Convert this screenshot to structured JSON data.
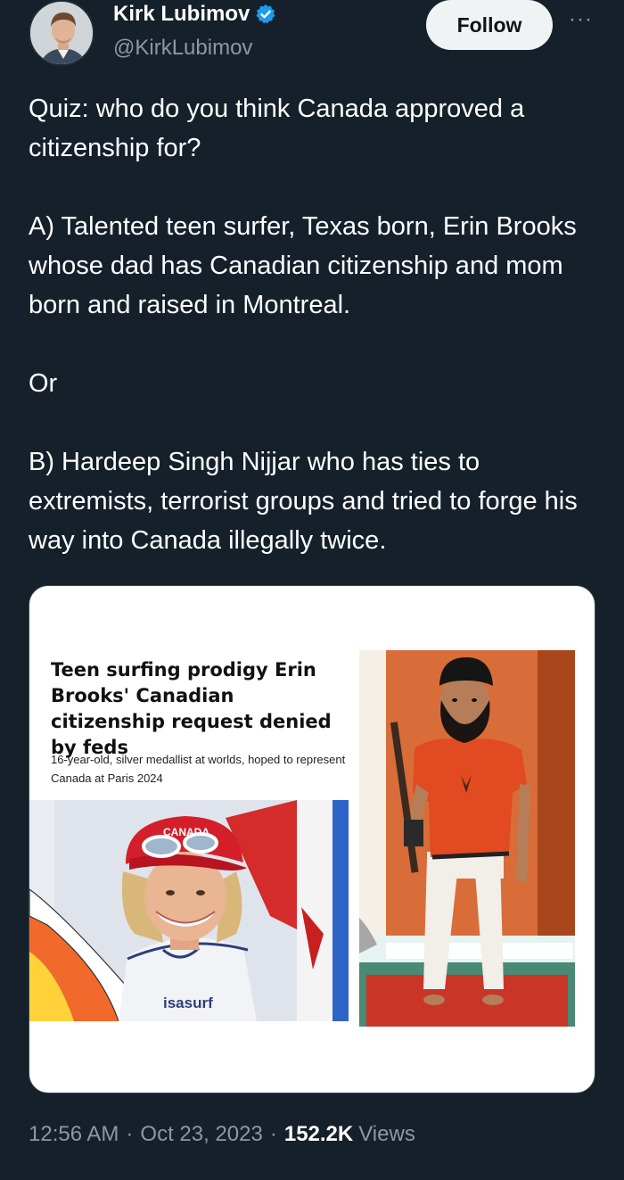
{
  "author": {
    "name": "Kirk Lubimov",
    "handle": "@KirkLubimov"
  },
  "actions": {
    "follow_label": "Follow",
    "more_label": "···"
  },
  "tweet": {
    "paragraphs": [
      "Quiz: who do you think Canada approved a citizenship for?",
      "A) Talented teen surfer, Texas born, Erin Brooks whose dad has Canadian citizenship and mom born and raised in Montreal.",
      "Or",
      "B) Hardeep Singh Nijjar who has ties to extremists, terrorist groups and tried to forge his way into Canada illegally twice."
    ]
  },
  "media": {
    "headline": "Teen surfing prodigy Erin Brooks' Canadian citizenship request denied by feds",
    "subhead": "16-year-old, silver medallist at worlds, hoped to represent Canada at Paris 2024",
    "shirt_text": "isasurf",
    "cap_text": "CANADA"
  },
  "meta": {
    "time": "12:56 AM",
    "date": "Oct 23, 2023",
    "views_count": "152.2K",
    "views_label": "Views",
    "separator": "·"
  },
  "colors": {
    "background": "#15202b",
    "secondary_text": "#8b98a5",
    "verified_blue": "#1d9bf0",
    "follow_bg": "#eff3f4"
  }
}
